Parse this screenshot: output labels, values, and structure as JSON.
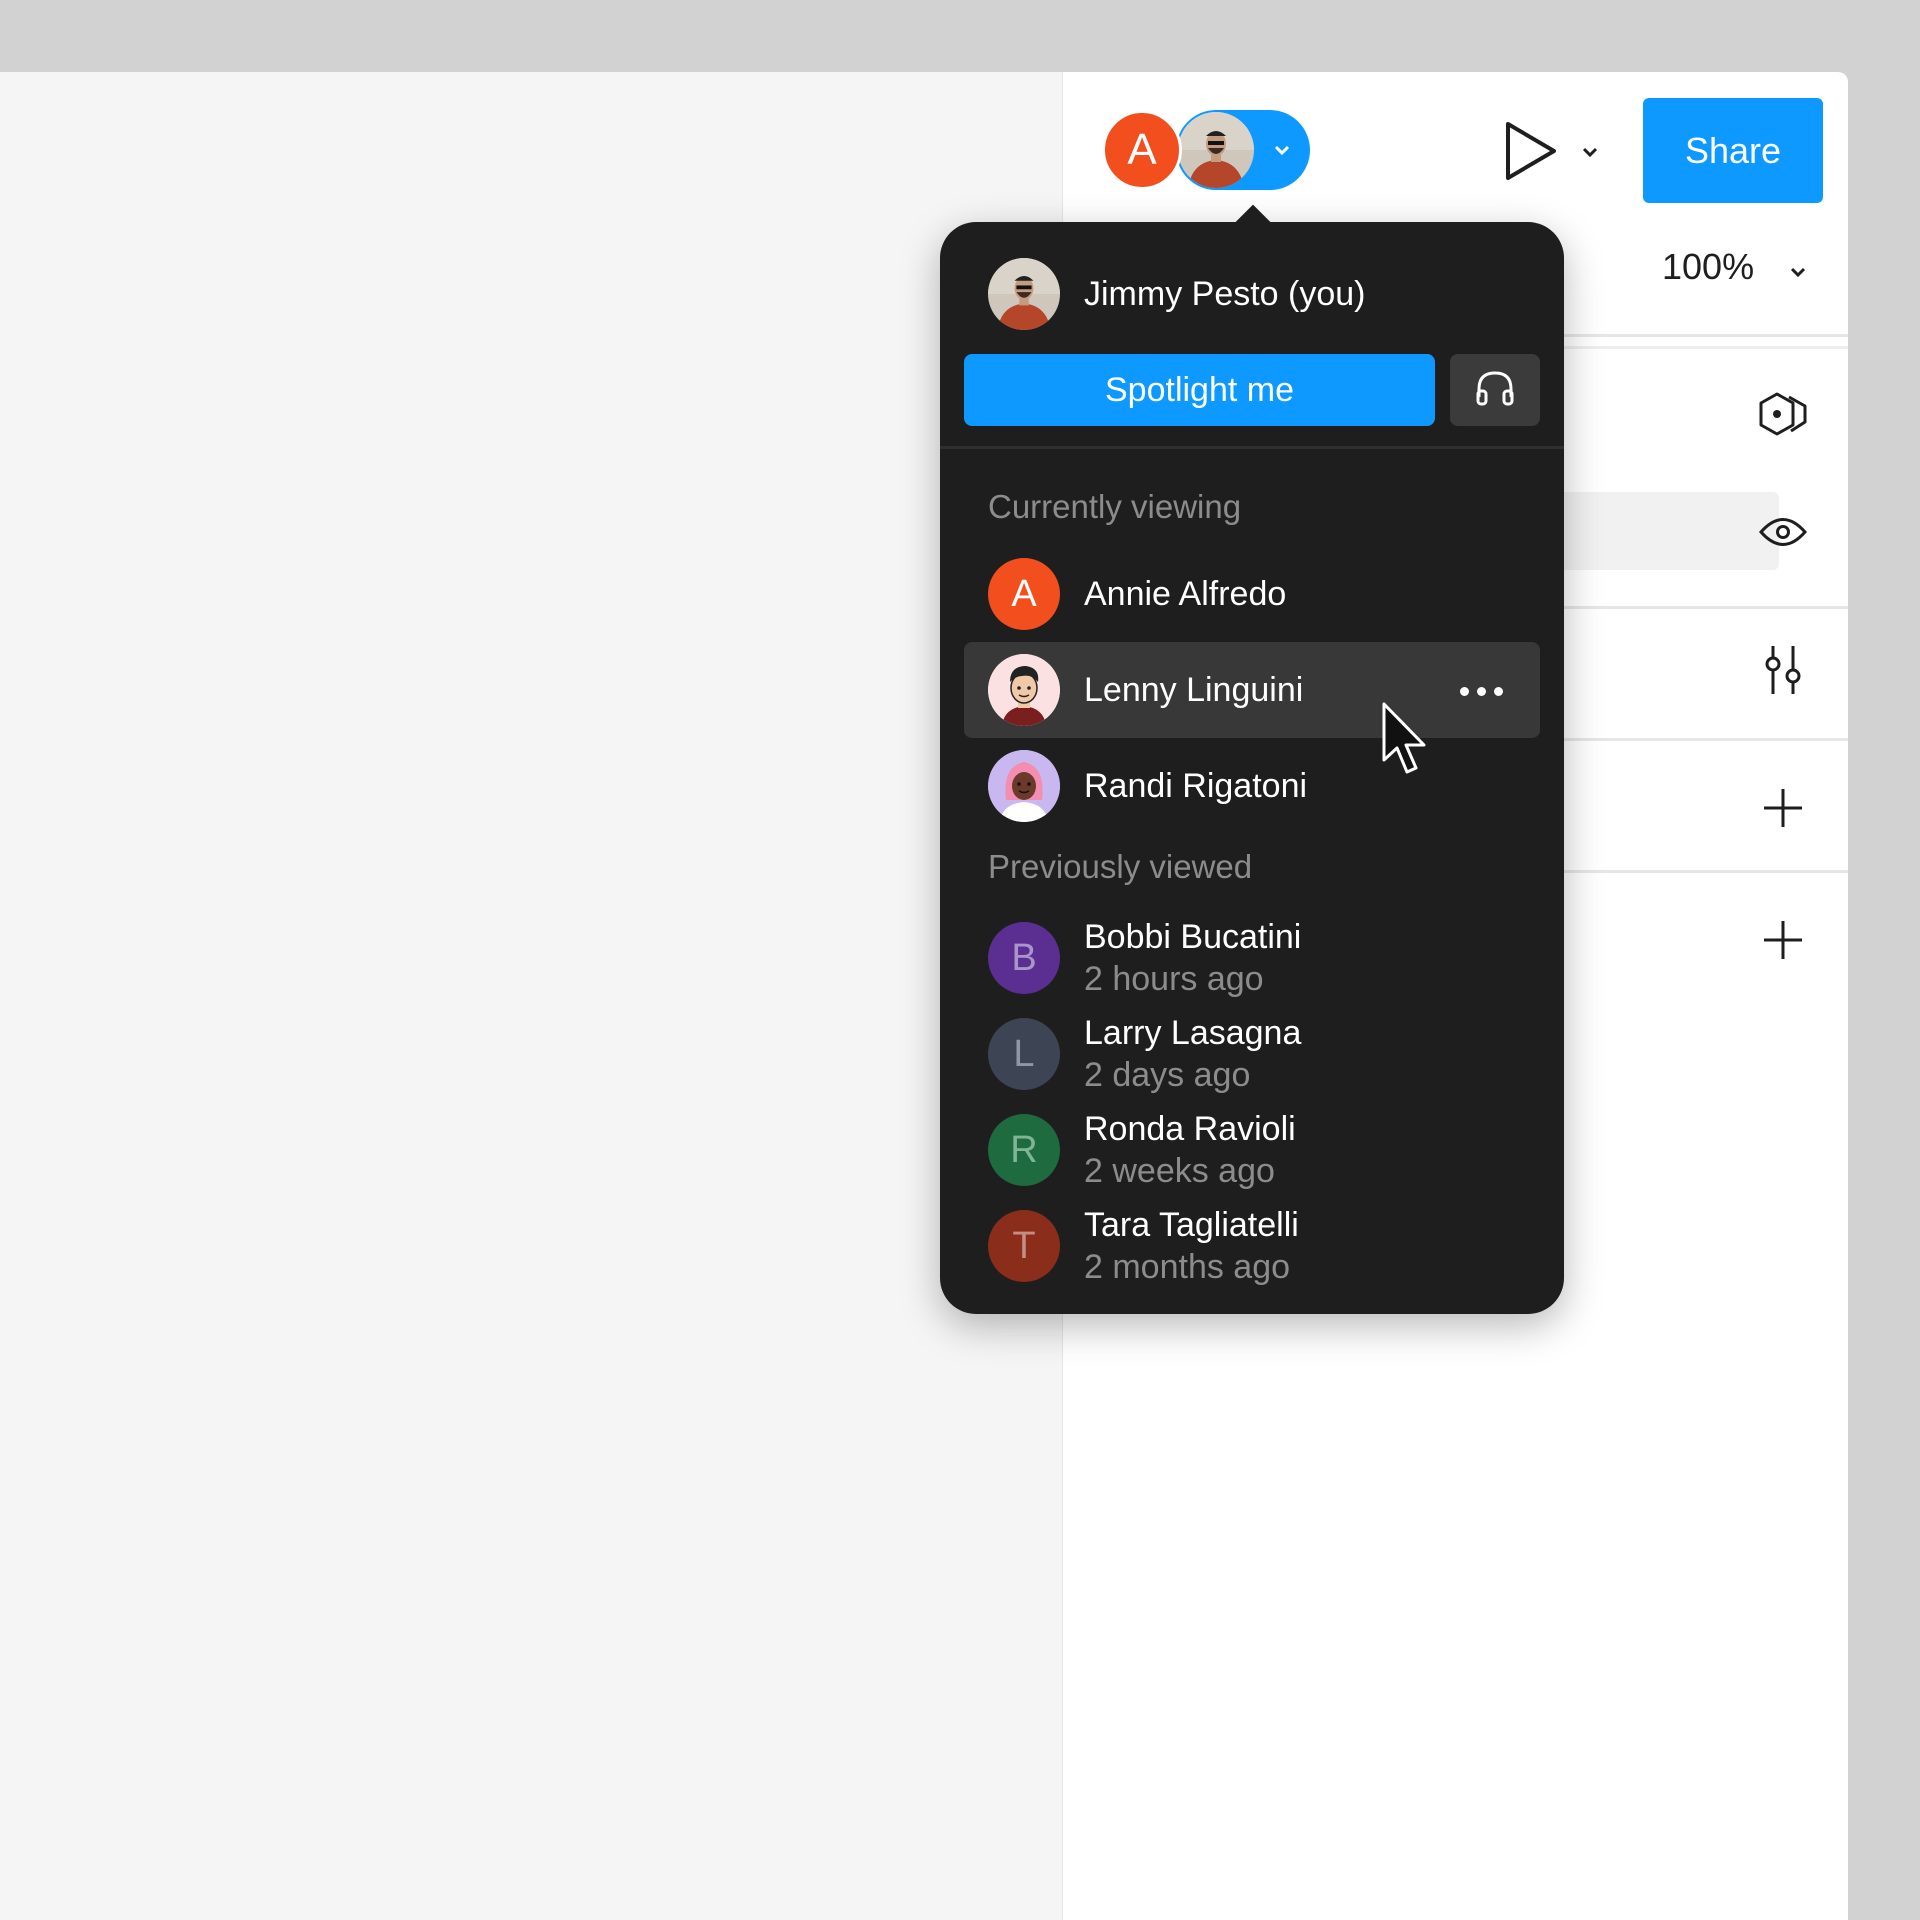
{
  "header": {
    "avatar_initial": "A",
    "share_label": "Share",
    "zoom_level": "100%"
  },
  "popover": {
    "current_user": "Jimmy Pesto (you)",
    "spotlight_label": "Spotlight me",
    "currently_viewing_label": "Currently viewing",
    "previously_viewed_label": "Previously viewed",
    "currently_viewing": [
      {
        "name": "Annie Alfredo",
        "initial": "A",
        "color": "#f24e1e"
      },
      {
        "name": "Lenny Linguini",
        "avatar": "illustrated-man"
      },
      {
        "name": "Randi Rigatoni",
        "avatar": "illustrated-woman"
      }
    ],
    "previously_viewed": [
      {
        "name": "Bobbi Bucatini",
        "time": "2 hours ago",
        "initial": "B",
        "color": "#5b2f91"
      },
      {
        "name": "Larry Lasagna",
        "time": "2 days ago",
        "initial": "L",
        "color": "#3d4554"
      },
      {
        "name": "Ronda Ravioli",
        "time": "2 weeks ago",
        "initial": "R",
        "color": "#1d6b3f"
      },
      {
        "name": "Tara Tagliatelli",
        "time": "2 months ago",
        "initial": "T",
        "color": "#8a2d1b"
      }
    ]
  },
  "colors": {
    "accent": "#0d99ff",
    "popover_bg": "#1e1e1e",
    "orange": "#f24e1e"
  }
}
